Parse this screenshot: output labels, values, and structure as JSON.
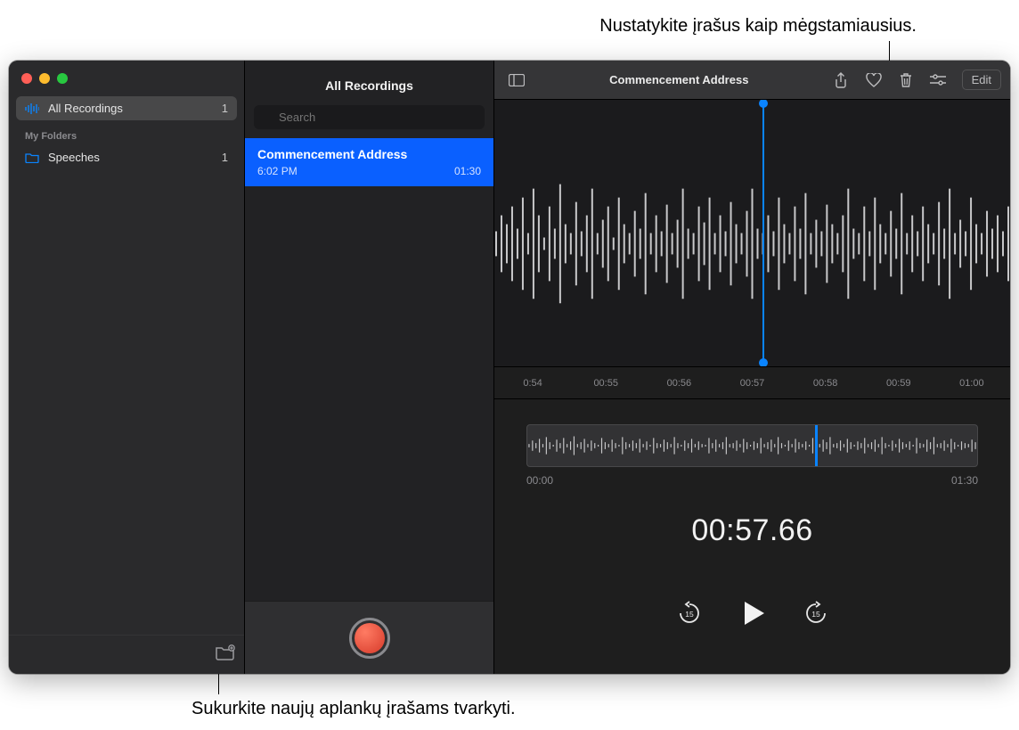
{
  "callouts": {
    "top": "Nustatykite įrašus kaip mėgstamiausius.",
    "bottom": "Sukurkite naujų aplankų įrašams tvarkyti."
  },
  "sidebar": {
    "all_recordings": {
      "label": "All Recordings",
      "count": "1"
    },
    "section_label": "My Folders",
    "folders": [
      {
        "label": "Speeches",
        "count": "1"
      }
    ]
  },
  "list": {
    "title": "All Recordings",
    "search_placeholder": "Search",
    "items": [
      {
        "name": "Commencement Address",
        "time": "6:02 PM",
        "duration": "01:30"
      }
    ]
  },
  "toolbar": {
    "title": "Commencement Address",
    "edit_label": "Edit"
  },
  "ruler": {
    "ticks": [
      "0:54",
      "00:55",
      "00:56",
      "00:57",
      "00:58",
      "00:59",
      "01:00"
    ]
  },
  "overview": {
    "start": "00:00",
    "end": "01:30"
  },
  "time_display": "00:57.66",
  "transport": {
    "skip_amount": "15"
  },
  "colors": {
    "accent": "#0a84ff",
    "selection": "#0a60ff",
    "record": "#ff3b30"
  }
}
